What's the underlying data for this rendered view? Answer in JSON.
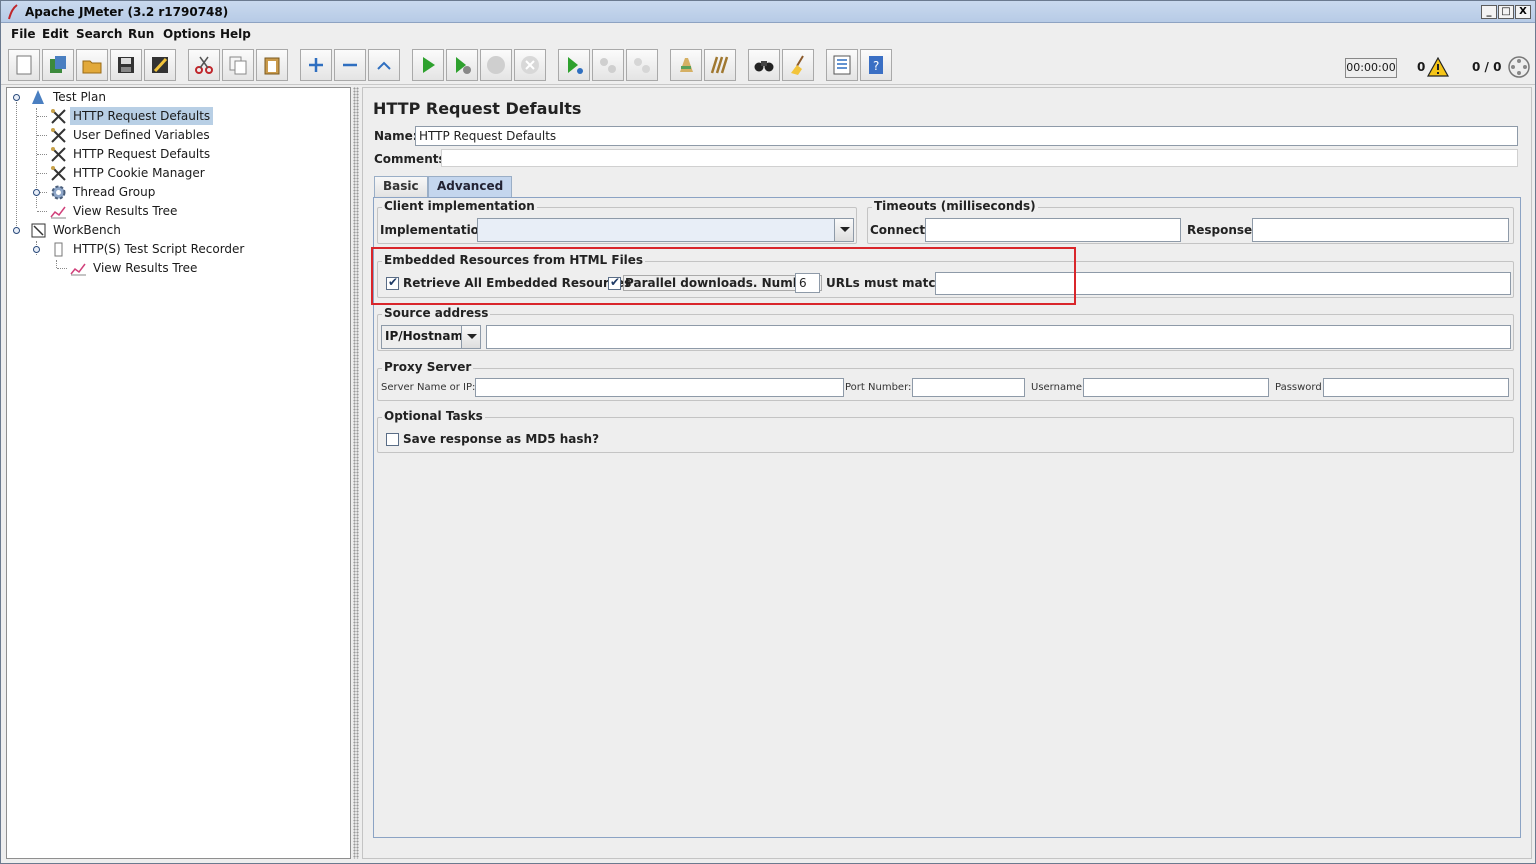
{
  "window": {
    "title": "Apache JMeter (3.2 r1790748)",
    "controls": [
      "_",
      "□",
      "X"
    ]
  },
  "menu": [
    "File",
    "Edit",
    "Search",
    "Run",
    "Options",
    "Help"
  ],
  "toolbar": {
    "icons": [
      "new-icon",
      "templates-icon",
      "open-icon",
      "save-icon",
      "save-as-icon",
      "cut-icon",
      "copy-icon",
      "paste-icon",
      "expand-icon",
      "collapse-icon",
      "toggle-icon",
      "start-icon",
      "start-no-pause-icon",
      "stop-icon",
      "shutdown-icon",
      "remote-start-icon",
      "remote-stop-icon",
      "remote-exit-icon",
      "clear-icon",
      "clear-all-icon",
      "search-icon",
      "reset-search-icon",
      "function-helper-icon",
      "help-icon"
    ],
    "timer": "00:00:00",
    "error_count": "0",
    "threads": "0 / 0"
  },
  "tree": {
    "items": [
      {
        "label": "Test Plan",
        "icon": "test-plan-icon"
      },
      {
        "label": "HTTP Request Defaults",
        "icon": "config-element-icon",
        "selected": true
      },
      {
        "label": "User Defined Variables",
        "icon": "config-element-icon"
      },
      {
        "label": "HTTP Request Defaults",
        "icon": "config-element-icon"
      },
      {
        "label": "HTTP Cookie Manager",
        "icon": "config-element-icon"
      },
      {
        "label": "Thread Group",
        "icon": "thread-group-icon"
      },
      {
        "label": "View Results Tree",
        "icon": "listener-icon"
      },
      {
        "label": "WorkBench",
        "icon": "workbench-icon"
      },
      {
        "label": "HTTP(S) Test Script Recorder",
        "icon": "recorder-icon"
      },
      {
        "label": "View Results Tree",
        "icon": "listener-icon"
      }
    ]
  },
  "panel": {
    "title": "HTTP Request Defaults",
    "name_label": "Name:",
    "name_value": "HTTP Request Defaults",
    "comments_label": "Comments:",
    "tabs": [
      "Basic",
      "Advanced"
    ],
    "active_tab": "Advanced",
    "client_impl": {
      "title": "Client implementation",
      "implementation_label": "Implementation:",
      "implementation_value": ""
    },
    "timeouts": {
      "title": "Timeouts (milliseconds)",
      "connect_label": "Connect:",
      "connect_value": "",
      "response_label": "Response:",
      "response_value": ""
    },
    "embedded": {
      "title": "Embedded Resources from HTML Files",
      "retrieve_label": "Retrieve All Embedded Resources",
      "retrieve_checked": true,
      "parallel_label": "Parallel downloads. Number:",
      "parallel_checked": true,
      "parallel_number": "6",
      "urls_label": "URLs must match:",
      "urls_value": ""
    },
    "source": {
      "title": "Source address",
      "type_value": "IP/Hostname",
      "address_value": ""
    },
    "proxy": {
      "title": "Proxy Server",
      "server_label": "Server Name or IP:",
      "port_label": "Port Number:",
      "username_label": "Username",
      "password_label": "Password"
    },
    "optional": {
      "title": "Optional Tasks",
      "md5_label": "Save response as MD5 hash?",
      "md5_checked": false
    }
  },
  "colors": {
    "highlight_box": "#d9262b",
    "selection": "#b8cfe5",
    "active_tab": "#c4d6ee"
  }
}
